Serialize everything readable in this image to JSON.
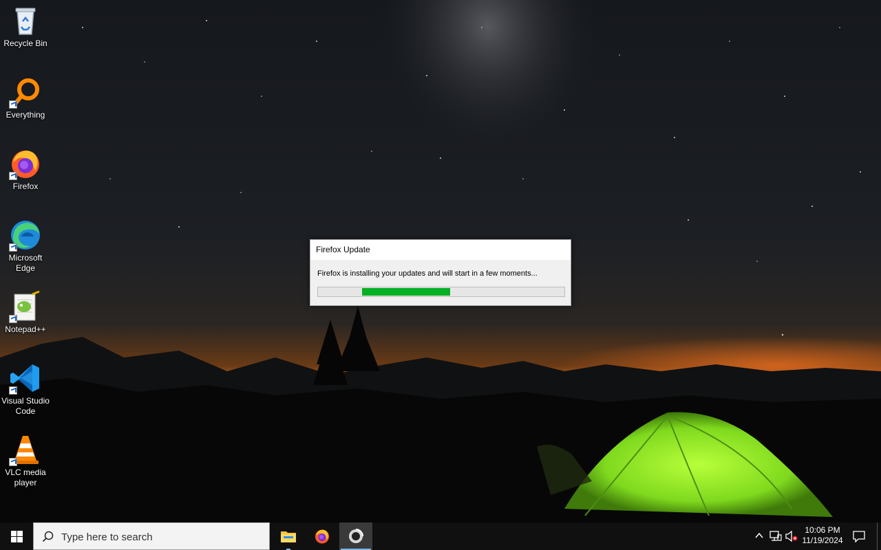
{
  "desktop": {
    "icons": [
      {
        "label_line1": "Recycle Bin",
        "label_line2": ""
      },
      {
        "label_line1": "Everything",
        "label_line2": ""
      },
      {
        "label_line1": "Firefox",
        "label_line2": ""
      },
      {
        "label_line1": "Microsoft",
        "label_line2": "Edge"
      },
      {
        "label_line1": "Notepad++",
        "label_line2": ""
      },
      {
        "label_line1": "Visual Studio",
        "label_line2": "Code"
      },
      {
        "label_line1": "VLC media",
        "label_line2": "player"
      }
    ]
  },
  "dialog": {
    "title": "Firefox Update",
    "message": "Firefox is installing your updates and will start in a few moments...",
    "progress_fraction": 0.355,
    "indeterminate": true,
    "progress_color": "#06b025"
  },
  "taskbar": {
    "search_placeholder": "Type here to search",
    "pinned": [
      "file-explorer-icon",
      "firefox-icon",
      "firefox-updater-icon"
    ],
    "accent": "#76b9ed"
  },
  "tray": {
    "time": "10:06 PM",
    "date": "11/19/2024",
    "icons": [
      "chevron-up-icon",
      "network-icon",
      "volume-muted-icon",
      "notification-icon"
    ]
  }
}
